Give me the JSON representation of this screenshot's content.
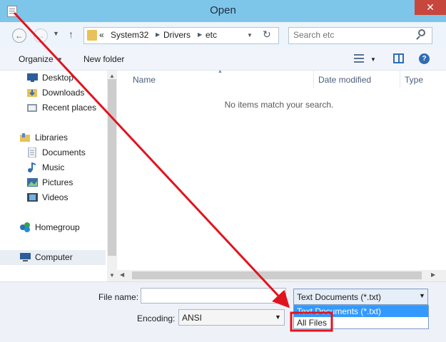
{
  "window": {
    "title": "Open",
    "close": "✕"
  },
  "nav": {
    "back": "←",
    "forward": "→",
    "recent": "▼",
    "up": "↑",
    "breadcrumb": [
      "System32",
      "Drivers",
      "etc"
    ],
    "breadcrumb_prefix": "«",
    "separator": "▶",
    "dropdown": "▼",
    "refresh": "↻",
    "search_placeholder": "Search etc"
  },
  "toolbar": {
    "organize_label": "Organize",
    "organize_caret": "▼",
    "new_folder_label": "New folder",
    "views_caret": "▼",
    "help": "?"
  },
  "sidebar": {
    "favorites": [
      {
        "label": "Desktop",
        "icon": "desktop-icon"
      },
      {
        "label": "Downloads",
        "icon": "downloads-icon"
      },
      {
        "label": "Recent places",
        "icon": "recent-places-icon"
      }
    ],
    "libraries": {
      "label": "Libraries",
      "items": [
        {
          "label": "Documents",
          "icon": "documents-icon"
        },
        {
          "label": "Music",
          "icon": "music-icon"
        },
        {
          "label": "Pictures",
          "icon": "pictures-icon"
        },
        {
          "label": "Videos",
          "icon": "videos-icon"
        }
      ]
    },
    "homegroup": "Homegroup",
    "computer": "Computer",
    "scroll_up": "▲",
    "scroll_down": "▼"
  },
  "file_list": {
    "columns": [
      "Name",
      "Date modified",
      "Type"
    ],
    "sort_indicator": "▲",
    "empty_message": "No items match your search.",
    "scroll_left": "◀",
    "scroll_right": "▶"
  },
  "bottom": {
    "file_name_label": "File name:",
    "file_name_value": "",
    "file_type_selected": "Text Documents (*.txt)",
    "file_type_options": [
      "Text Documents (*.txt)",
      "All Files"
    ],
    "encoding_label": "Encoding:",
    "encoding_value": "ANSI",
    "caret": "▼"
  },
  "colors": {
    "titlebar": "#7ec5ea",
    "close": "#c7463d",
    "selection": "#3399ff",
    "annotation": "#e0141e"
  }
}
